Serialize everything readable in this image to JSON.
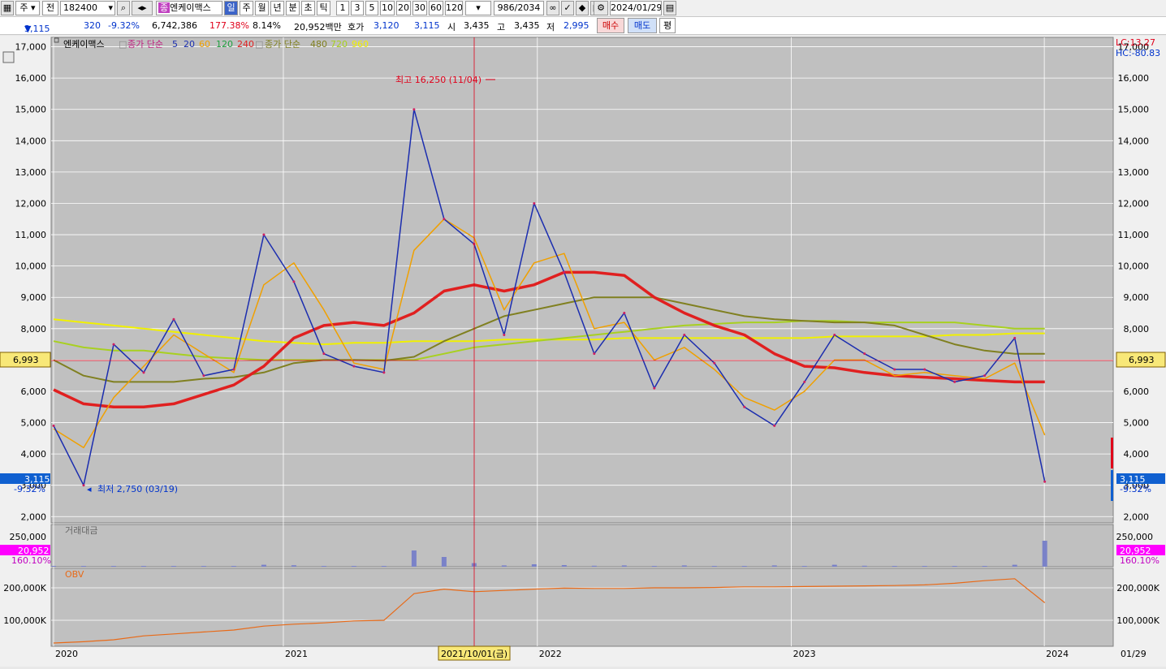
{
  "toolbar": {
    "mode": "주",
    "full_label": "전",
    "code": "182400",
    "company": "엔케이맥스",
    "company_prefix": "종",
    "periods": [
      "일",
      "주",
      "월",
      "년",
      "분",
      "초",
      "틱"
    ],
    "intervals": [
      "1",
      "3",
      "5",
      "10",
      "20",
      "30",
      "60",
      "120"
    ],
    "count": "986",
    "count_total": "2034",
    "date": "2024/01/29"
  },
  "quote": {
    "price": "3,115",
    "arrow": "▼",
    "change": "320",
    "change_pct": "-9.32%",
    "volume": "6,742,386",
    "volume_ratio": "177.38%",
    "turnover": "8.14%",
    "amount": "20,952백만",
    "bid_label": "호가",
    "bid": "3,120",
    "ask": "3,115",
    "open_label": "시",
    "open": "3,435",
    "high_label": "고",
    "high": "3,435",
    "low_label": "저",
    "low": "2,995",
    "buy_btn": "매수",
    "sell_btn": "매도",
    "avg_btn": "평"
  },
  "colors": {
    "up": "#e0001a",
    "down": "#0033cc",
    "ma5": "#1b2fb0",
    "ma20": "#f0a000",
    "ma60": "#20a040",
    "ma120": "#e02020",
    "ma240": "#808020",
    "ma480": "#a8d020",
    "ma960": "#f0f000",
    "obv": "#e86a18",
    "volume": "#7a82c8"
  },
  "legend": {
    "name": "엔케이맥스",
    "ma_label": "종가 단순",
    "ma_short": [
      "5",
      "20",
      "60",
      "120",
      "240"
    ],
    "ma_long_label": "종가 단순",
    "ma_long": [
      "480",
      "720",
      "960"
    ]
  },
  "indicators": {
    "lc": "LC:13.27",
    "hc": "HC:-80.83",
    "volume_title": "거래대금",
    "obv_title": "OBV"
  },
  "annotations": {
    "max": "최고 16,250 (11/04)",
    "min": "최저 2,750 (03/19)",
    "crosshair_date": "2021/10/01(금)",
    "crosshair_value": "6,993",
    "last_price": "3,115",
    "last_change": "-9.32%",
    "vol_value": "20,952",
    "vol_pct": "160.10%",
    "last_date": "01/29"
  },
  "chart_data": {
    "type": "line",
    "price_ticks": [
      "17,000",
      "16,000",
      "15,000",
      "14,000",
      "13,000",
      "12,000",
      "11,000",
      "10,000",
      "9,000",
      "8,000",
      "7,000",
      "6,000",
      "5,000",
      "4,000",
      "3,000",
      "2,000"
    ],
    "price_ylim": [
      1800,
      17300
    ],
    "volume_ticks": [
      "250,000"
    ],
    "obv_ticks": [
      "200,000K",
      "100,000K"
    ],
    "x_labels": [
      "2020",
      "2021",
      "2022",
      "2023",
      "2024"
    ],
    "x": [
      0,
      0.03,
      0.06,
      0.09,
      0.12,
      0.15,
      0.18,
      0.21,
      0.24,
      0.27,
      0.3,
      0.33,
      0.36,
      0.39,
      0.42,
      0.45,
      0.48,
      0.51,
      0.54,
      0.57,
      0.6,
      0.63,
      0.66,
      0.69,
      0.72,
      0.75,
      0.78,
      0.81,
      0.84,
      0.87,
      0.9,
      0.93,
      0.96,
      0.99
    ],
    "x_note": "fraction of plotted period",
    "close": [
      4900,
      3000,
      7500,
      6600,
      8300,
      6500,
      6700,
      11000,
      9500,
      7200,
      6800,
      6600,
      15000,
      11500,
      10700,
      7800,
      12000,
      9800,
      7200,
      8500,
      6100,
      7800,
      6900,
      5500,
      4900,
      6300,
      7800,
      7200,
      6700,
      6700,
      6300,
      6500,
      7700,
      3115
    ],
    "ma20": [
      4800,
      4200,
      5800,
      6800,
      7800,
      7200,
      6600,
      9400,
      10100,
      8600,
      6900,
      6700,
      10500,
      11500,
      10900,
      8600,
      10100,
      10400,
      8000,
      8200,
      7000,
      7400,
      6700,
      5800,
      5400,
      6000,
      7000,
      7000,
      6500,
      6600,
      6500,
      6400,
      6900,
      4600
    ],
    "ma120": [
      6050,
      5600,
      5500,
      5500,
      5600,
      5900,
      6200,
      6800,
      7700,
      8100,
      8200,
      8100,
      8500,
      9200,
      9400,
      9200,
      9400,
      9800,
      9800,
      9700,
      9000,
      8500,
      8100,
      7800,
      7200,
      6800,
      6750,
      6600,
      6500,
      6450,
      6400,
      6350,
      6300,
      6300
    ],
    "ma240": [
      7000,
      6500,
      6300,
      6300,
      6300,
      6400,
      6450,
      6600,
      6900,
      7000,
      7000,
      6980,
      7100,
      7600,
      8000,
      8400,
      8600,
      8800,
      9000,
      9000,
      9000,
      8800,
      8600,
      8400,
      8300,
      8250,
      8200,
      8200,
      8100,
      7800,
      7500,
      7300,
      7200,
      7200
    ],
    "ma480": [
      7600,
      7400,
      7300,
      7300,
      7200,
      7100,
      7050,
      7000,
      7000,
      7000,
      7000,
      7000,
      7000,
      7200,
      7400,
      7500,
      7600,
      7700,
      7800,
      7900,
      8000,
      8100,
      8150,
      8200,
      8200,
      8250,
      8250,
      8200,
      8200,
      8200,
      8200,
      8100,
      8000,
      8000
    ],
    "ma960": [
      8300,
      8200,
      8100,
      8000,
      7900,
      7800,
      7700,
      7600,
      7550,
      7500,
      7550,
      7550,
      7600,
      7600,
      7600,
      7650,
      7650,
      7650,
      7650,
      7700,
      7700,
      7700,
      7700,
      7700,
      7700,
      7700,
      7750,
      7750,
      7750,
      7750,
      7800,
      7800,
      7850,
      7850
    ],
    "volume": [
      3,
      2,
      4,
      2,
      3,
      2,
      3,
      12,
      9,
      5,
      4,
      3,
      100,
      60,
      22,
      8,
      15,
      10,
      6,
      8,
      4,
      8,
      5,
      4,
      8,
      5,
      12,
      6,
      4,
      4,
      3,
      4,
      12,
      160
    ],
    "volume_max": 260000,
    "obv": [
      30,
      34,
      40,
      52,
      58,
      64,
      70,
      82,
      88,
      92,
      98,
      100,
      182,
      196,
      188,
      192,
      196,
      199,
      198,
      198,
      200,
      200,
      201,
      203,
      203,
      204,
      205,
      206,
      207,
      209,
      214,
      222,
      228,
      154
    ],
    "obv_ylim": [
      20,
      260
    ]
  }
}
